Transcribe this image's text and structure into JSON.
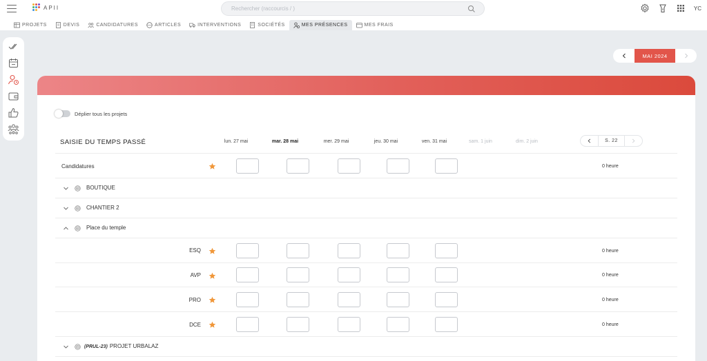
{
  "app": {
    "logo_text": "APII"
  },
  "search": {
    "placeholder": "Rechercher (raccourcis / )"
  },
  "user": {
    "initials": "YC"
  },
  "nav_tabs": [
    {
      "label": "PROJETS",
      "icon": "table-icon"
    },
    {
      "label": "DEVIS",
      "icon": "document-icon"
    },
    {
      "label": "CANDIDATURES",
      "icon": "users-icon"
    },
    {
      "label": "ARTICLES",
      "icon": "articles-icon"
    },
    {
      "label": "INTERVENTIONS",
      "icon": "truck-icon"
    },
    {
      "label": "SOCIÉTÉS",
      "icon": "building-icon"
    },
    {
      "label": "MES PRÉSENCES",
      "icon": "user-clock-icon",
      "active": true
    },
    {
      "label": "MES FRAIS",
      "icon": "wallet-icon"
    }
  ],
  "month_nav": {
    "label": "MAI 2024"
  },
  "toggle": {
    "label": "Déplier tous les projets"
  },
  "table": {
    "title": "SAISIE DU TEMPS PASSÉ",
    "days": [
      {
        "label": "lun. 27 mai",
        "style": "normal"
      },
      {
        "label": "mar. 28 mai",
        "style": "bold"
      },
      {
        "label": "mer. 29 mai",
        "style": "normal"
      },
      {
        "label": "jeu. 30 mai",
        "style": "normal"
      },
      {
        "label": "ven. 31 mai",
        "style": "normal"
      },
      {
        "label": "sam. 1 juin",
        "style": "muted"
      },
      {
        "label": "dim. 2 juin",
        "style": "muted"
      }
    ],
    "week_label": "S. 22",
    "candidatures": {
      "label": "Candidatures",
      "hours": "0 heure"
    },
    "projects": [
      {
        "code": "",
        "name": "BOUTIQUE",
        "expanded": false
      },
      {
        "code": "",
        "name": "CHANTIER 2",
        "expanded": false
      },
      {
        "code": "",
        "name": "Place du temple",
        "expanded": true,
        "phases": [
          {
            "label": "ESQ",
            "hours": "0 heure"
          },
          {
            "label": "AVP",
            "hours": "0 heure"
          },
          {
            "label": "PRO",
            "hours": "0 heure"
          },
          {
            "label": "DCE",
            "hours": "0 heure"
          }
        ]
      },
      {
        "code": "(PRUL-23)",
        "name": "PROJET URBALAZ",
        "expanded": false
      }
    ]
  },
  "colors": {
    "accent": "#e2554a",
    "star": "#f0973a"
  }
}
